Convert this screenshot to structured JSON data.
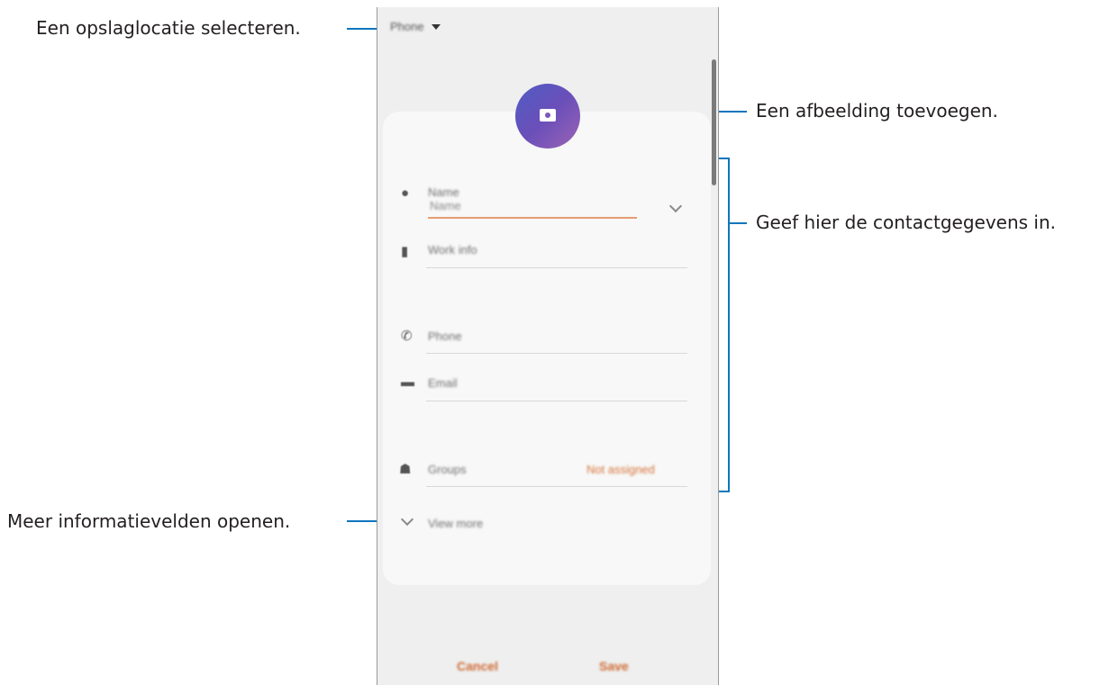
{
  "callouts": {
    "storage": "Een opslaglocatie selecteren.",
    "image": "Een afbeelding toevoegen.",
    "details": "Geef hier de contactgegevens in.",
    "more": "Meer informatievelden openen."
  },
  "phone": {
    "storage_selector": "Phone",
    "fields": {
      "name_header": "Name",
      "name_input": "Name",
      "work_info": "Work info",
      "phone": "Phone",
      "email": "Email",
      "groups": "Groups",
      "groups_value": "Not assigned",
      "view_more": "View more"
    },
    "buttons": {
      "cancel": "Cancel",
      "save": "Save"
    }
  },
  "colors": {
    "accent_line": "#0e76bc",
    "orange": "#d9733c",
    "avatar_start": "#4f5cc4",
    "avatar_end": "#9b63b5"
  }
}
